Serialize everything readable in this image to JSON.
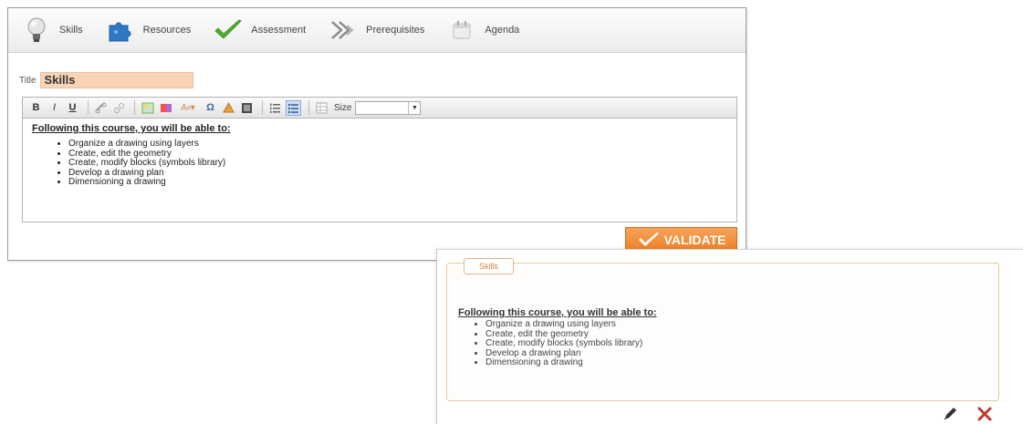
{
  "editor": {
    "tabs": [
      {
        "label": "Skills",
        "icon": "lightbulb-icon"
      },
      {
        "label": "Resources",
        "icon": "puzzle-icon"
      },
      {
        "label": "Assessment",
        "icon": "checkmark-icon"
      },
      {
        "label": "Prerequisites",
        "icon": "double-arrow-icon"
      },
      {
        "label": "Agenda",
        "icon": "calendar-icon"
      }
    ],
    "title_label": "Title",
    "title_value": "Skills",
    "toolbar": {
      "size_label": "Size",
      "size_value": ""
    },
    "content": {
      "heading": "Following this course, you will be able to:",
      "items": [
        "Organize a drawing using layers",
        "Create, edit the geometry",
        "Create, modify blocks (symbols library)",
        "Develop a drawing plan",
        "Dimensioning a drawing"
      ]
    },
    "validate_label": "VALIDATE"
  },
  "preview": {
    "tab_label": "Skills",
    "heading": "Following this course, you will be able to:",
    "items": [
      "Organize a drawing using layers",
      "Create, edit the geometry",
      "Create, modify blocks (symbols library)",
      "Develop a drawing plan",
      "Dimensioning a drawing"
    ]
  },
  "colors": {
    "accent_orange": "#ef7f24",
    "title_field_bg": "#f8d3b5",
    "delete_red": "#c0392b",
    "check_green": "#4caf2a"
  }
}
